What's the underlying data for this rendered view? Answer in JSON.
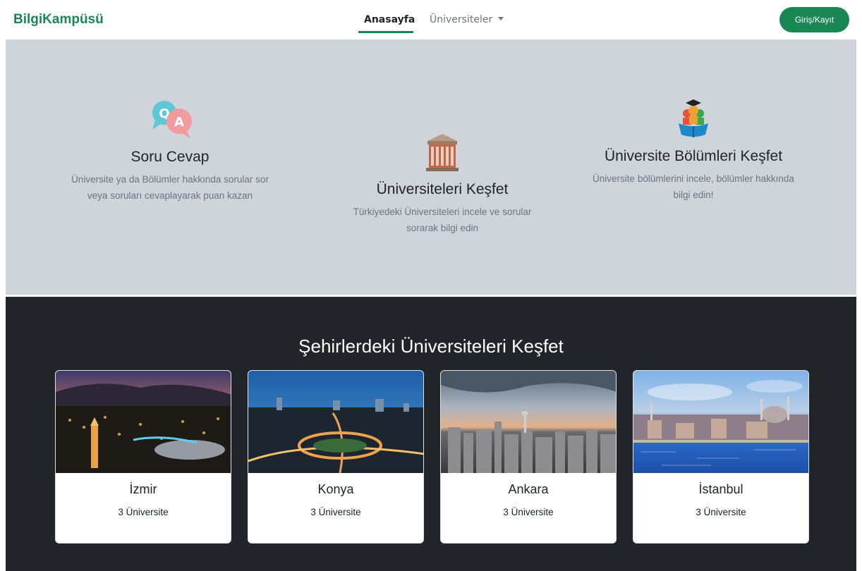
{
  "navbar": {
    "brand": "BilgiKampüsü",
    "links": [
      {
        "label": "Anasayfa"
      },
      {
        "label": "Üniversiteler"
      }
    ],
    "login_label": "Giriş/Kayıt",
    "accent": "#198754"
  },
  "features": [
    {
      "icon": "qa-bubbles-icon",
      "title": "Soru Cevap",
      "text": "Üniversite ya da Bölümler hakkında sorular sor veya soruları cevaplayarak puan kazan"
    },
    {
      "icon": "university-building-icon",
      "title": "Üniversiteleri Keşfet",
      "text": "Türkiyedeki Üniversiteleri incele ve sorular sorarak bilgi edin"
    },
    {
      "icon": "graduates-book-icon",
      "title": "Üniversite Bölümleri Keşfet",
      "text": "Üniversite bölümlerini incele, bölümler hakkında bilgi edin!"
    }
  ],
  "cities_section": {
    "title": "Şehirlerdeki Üniversiteleri Keşfet",
    "cards": [
      {
        "city": "İzmir",
        "count": "3 Üniversite"
      },
      {
        "city": "Konya",
        "count": "3 Üniversite"
      },
      {
        "city": "Ankara",
        "count": "3 Üniversite"
      },
      {
        "city": "İstanbul",
        "count": "3 Üniversite"
      }
    ]
  }
}
